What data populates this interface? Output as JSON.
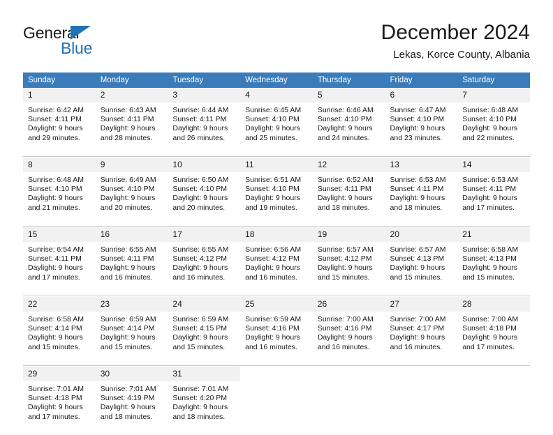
{
  "brand": {
    "name_part1": "General",
    "name_part2": "Blue",
    "accent_color": "#1f72b8"
  },
  "header": {
    "month_title": "December 2024",
    "location": "Lekas, Korce County, Albania"
  },
  "calendar": {
    "header_background": "#3a7cba",
    "daynum_background": "#f1f1f1",
    "weekday_headers": [
      "Sunday",
      "Monday",
      "Tuesday",
      "Wednesday",
      "Thursday",
      "Friday",
      "Saturday"
    ],
    "weeks": [
      {
        "days": [
          {
            "num": "1",
            "sunrise": "Sunrise: 6:42 AM",
            "sunset": "Sunset: 4:11 PM",
            "daylight_line1": "Daylight: 9 hours",
            "daylight_line2": "and 29 minutes."
          },
          {
            "num": "2",
            "sunrise": "Sunrise: 6:43 AM",
            "sunset": "Sunset: 4:11 PM",
            "daylight_line1": "Daylight: 9 hours",
            "daylight_line2": "and 28 minutes."
          },
          {
            "num": "3",
            "sunrise": "Sunrise: 6:44 AM",
            "sunset": "Sunset: 4:11 PM",
            "daylight_line1": "Daylight: 9 hours",
            "daylight_line2": "and 26 minutes."
          },
          {
            "num": "4",
            "sunrise": "Sunrise: 6:45 AM",
            "sunset": "Sunset: 4:10 PM",
            "daylight_line1": "Daylight: 9 hours",
            "daylight_line2": "and 25 minutes."
          },
          {
            "num": "5",
            "sunrise": "Sunrise: 6:46 AM",
            "sunset": "Sunset: 4:10 PM",
            "daylight_line1": "Daylight: 9 hours",
            "daylight_line2": "and 24 minutes."
          },
          {
            "num": "6",
            "sunrise": "Sunrise: 6:47 AM",
            "sunset": "Sunset: 4:10 PM",
            "daylight_line1": "Daylight: 9 hours",
            "daylight_line2": "and 23 minutes."
          },
          {
            "num": "7",
            "sunrise": "Sunrise: 6:48 AM",
            "sunset": "Sunset: 4:10 PM",
            "daylight_line1": "Daylight: 9 hours",
            "daylight_line2": "and 22 minutes."
          }
        ]
      },
      {
        "days": [
          {
            "num": "8",
            "sunrise": "Sunrise: 6:48 AM",
            "sunset": "Sunset: 4:10 PM",
            "daylight_line1": "Daylight: 9 hours",
            "daylight_line2": "and 21 minutes."
          },
          {
            "num": "9",
            "sunrise": "Sunrise: 6:49 AM",
            "sunset": "Sunset: 4:10 PM",
            "daylight_line1": "Daylight: 9 hours",
            "daylight_line2": "and 20 minutes."
          },
          {
            "num": "10",
            "sunrise": "Sunrise: 6:50 AM",
            "sunset": "Sunset: 4:10 PM",
            "daylight_line1": "Daylight: 9 hours",
            "daylight_line2": "and 20 minutes."
          },
          {
            "num": "11",
            "sunrise": "Sunrise: 6:51 AM",
            "sunset": "Sunset: 4:10 PM",
            "daylight_line1": "Daylight: 9 hours",
            "daylight_line2": "and 19 minutes."
          },
          {
            "num": "12",
            "sunrise": "Sunrise: 6:52 AM",
            "sunset": "Sunset: 4:11 PM",
            "daylight_line1": "Daylight: 9 hours",
            "daylight_line2": "and 18 minutes."
          },
          {
            "num": "13",
            "sunrise": "Sunrise: 6:53 AM",
            "sunset": "Sunset: 4:11 PM",
            "daylight_line1": "Daylight: 9 hours",
            "daylight_line2": "and 18 minutes."
          },
          {
            "num": "14",
            "sunrise": "Sunrise: 6:53 AM",
            "sunset": "Sunset: 4:11 PM",
            "daylight_line1": "Daylight: 9 hours",
            "daylight_line2": "and 17 minutes."
          }
        ]
      },
      {
        "days": [
          {
            "num": "15",
            "sunrise": "Sunrise: 6:54 AM",
            "sunset": "Sunset: 4:11 PM",
            "daylight_line1": "Daylight: 9 hours",
            "daylight_line2": "and 17 minutes."
          },
          {
            "num": "16",
            "sunrise": "Sunrise: 6:55 AM",
            "sunset": "Sunset: 4:11 PM",
            "daylight_line1": "Daylight: 9 hours",
            "daylight_line2": "and 16 minutes."
          },
          {
            "num": "17",
            "sunrise": "Sunrise: 6:55 AM",
            "sunset": "Sunset: 4:12 PM",
            "daylight_line1": "Daylight: 9 hours",
            "daylight_line2": "and 16 minutes."
          },
          {
            "num": "18",
            "sunrise": "Sunrise: 6:56 AM",
            "sunset": "Sunset: 4:12 PM",
            "daylight_line1": "Daylight: 9 hours",
            "daylight_line2": "and 16 minutes."
          },
          {
            "num": "19",
            "sunrise": "Sunrise: 6:57 AM",
            "sunset": "Sunset: 4:12 PM",
            "daylight_line1": "Daylight: 9 hours",
            "daylight_line2": "and 15 minutes."
          },
          {
            "num": "20",
            "sunrise": "Sunrise: 6:57 AM",
            "sunset": "Sunset: 4:13 PM",
            "daylight_line1": "Daylight: 9 hours",
            "daylight_line2": "and 15 minutes."
          },
          {
            "num": "21",
            "sunrise": "Sunrise: 6:58 AM",
            "sunset": "Sunset: 4:13 PM",
            "daylight_line1": "Daylight: 9 hours",
            "daylight_line2": "and 15 minutes."
          }
        ]
      },
      {
        "days": [
          {
            "num": "22",
            "sunrise": "Sunrise: 6:58 AM",
            "sunset": "Sunset: 4:14 PM",
            "daylight_line1": "Daylight: 9 hours",
            "daylight_line2": "and 15 minutes."
          },
          {
            "num": "23",
            "sunrise": "Sunrise: 6:59 AM",
            "sunset": "Sunset: 4:14 PM",
            "daylight_line1": "Daylight: 9 hours",
            "daylight_line2": "and 15 minutes."
          },
          {
            "num": "24",
            "sunrise": "Sunrise: 6:59 AM",
            "sunset": "Sunset: 4:15 PM",
            "daylight_line1": "Daylight: 9 hours",
            "daylight_line2": "and 15 minutes."
          },
          {
            "num": "25",
            "sunrise": "Sunrise: 6:59 AM",
            "sunset": "Sunset: 4:16 PM",
            "daylight_line1": "Daylight: 9 hours",
            "daylight_line2": "and 16 minutes."
          },
          {
            "num": "26",
            "sunrise": "Sunrise: 7:00 AM",
            "sunset": "Sunset: 4:16 PM",
            "daylight_line1": "Daylight: 9 hours",
            "daylight_line2": "and 16 minutes."
          },
          {
            "num": "27",
            "sunrise": "Sunrise: 7:00 AM",
            "sunset": "Sunset: 4:17 PM",
            "daylight_line1": "Daylight: 9 hours",
            "daylight_line2": "and 16 minutes."
          },
          {
            "num": "28",
            "sunrise": "Sunrise: 7:00 AM",
            "sunset": "Sunset: 4:18 PM",
            "daylight_line1": "Daylight: 9 hours",
            "daylight_line2": "and 17 minutes."
          }
        ]
      },
      {
        "days": [
          {
            "num": "29",
            "sunrise": "Sunrise: 7:01 AM",
            "sunset": "Sunset: 4:18 PM",
            "daylight_line1": "Daylight: 9 hours",
            "daylight_line2": "and 17 minutes."
          },
          {
            "num": "30",
            "sunrise": "Sunrise: 7:01 AM",
            "sunset": "Sunset: 4:19 PM",
            "daylight_line1": "Daylight: 9 hours",
            "daylight_line2": "and 18 minutes."
          },
          {
            "num": "31",
            "sunrise": "Sunrise: 7:01 AM",
            "sunset": "Sunset: 4:20 PM",
            "daylight_line1": "Daylight: 9 hours",
            "daylight_line2": "and 18 minutes."
          },
          {
            "num": "",
            "sunrise": "",
            "sunset": "",
            "daylight_line1": "",
            "daylight_line2": ""
          },
          {
            "num": "",
            "sunrise": "",
            "sunset": "",
            "daylight_line1": "",
            "daylight_line2": ""
          },
          {
            "num": "",
            "sunrise": "",
            "sunset": "",
            "daylight_line1": "",
            "daylight_line2": ""
          },
          {
            "num": "",
            "sunrise": "",
            "sunset": "",
            "daylight_line1": "",
            "daylight_line2": ""
          }
        ]
      }
    ]
  }
}
